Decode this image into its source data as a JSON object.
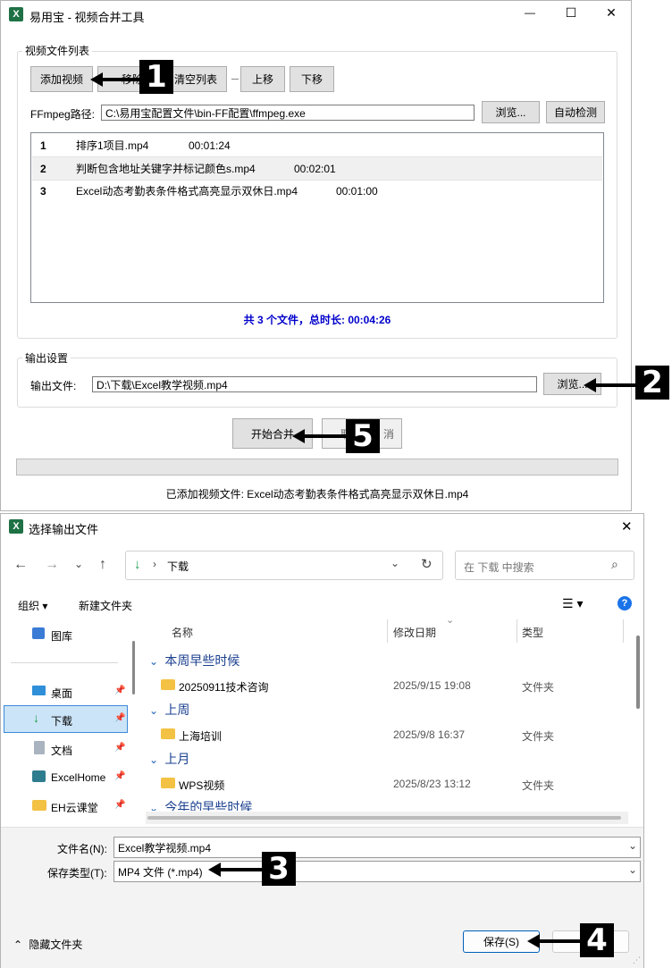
{
  "merge_tool": {
    "title": "易用宝 - 视频合并工具",
    "app_icon": "X",
    "window_controls": {
      "minimize": "—",
      "maximize": "☐",
      "close": "✕"
    },
    "file_group_label": "视频文件列表",
    "buttons": {
      "add": "添加视频",
      "remove": "移除选",
      "clear": "清空列表",
      "up": "上移",
      "down": "下移"
    },
    "ffmpeg_label": "FFmpeg路径:",
    "ffmpeg_path": "C:\\易用宝配置文件\\bin-FF配置\\ffmpeg.exe",
    "browse": "浏览...",
    "auto_detect": "自动检测",
    "files": [
      {
        "index": "1",
        "name": "排序1项目.mp4",
        "duration": "00:01:24"
      },
      {
        "index": "2",
        "name": "判断包含地址关键字并标记颜色s.mp4",
        "duration": "00:02:01"
      },
      {
        "index": "3",
        "name": "Excel动态考勤表条件格式高亮显示双休日.mp4",
        "duration": "00:01:00"
      }
    ],
    "summary": "共 3 个文件，总时长: 00:04:26",
    "output_group_label": "输出设置",
    "output_label": "输出文件:",
    "output_path": "D:\\下载\\Excel教学视频.mp4",
    "output_browse": "浏览...",
    "start_merge": "开始合并",
    "cancel_partial": "取",
    "cancel_tail": "消",
    "progress": 0,
    "status": "已添加视频文件: Excel动态考勤表条件格式高亮显示双休日.mp4"
  },
  "save_dialog": {
    "title": "选择输出文件",
    "close": "✕",
    "breadcrumb": "下载",
    "search_placeholder": "在 下载 中搜索",
    "organize": "组织 ▾",
    "new_folder": "新建文件夹",
    "nav_items": [
      {
        "label": "图库",
        "icon": "gallery-icon"
      },
      {
        "label": "桌面",
        "icon": "desktop-icon"
      },
      {
        "label": "下载",
        "icon": "download-icon"
      },
      {
        "label": "文档",
        "icon": "documents-icon"
      },
      {
        "label": "ExcelHome",
        "icon": "network-icon"
      },
      {
        "label": "EH云课堂",
        "icon": "folder-icon"
      }
    ],
    "columns": {
      "name": "名称",
      "date": "修改日期",
      "type": "类型"
    },
    "groups": [
      {
        "label": "本周早些时候",
        "items": [
          {
            "name": "20250911技术咨询",
            "date": "2025/9/15 19:08",
            "type": "文件夹"
          }
        ]
      },
      {
        "label": "上周",
        "items": [
          {
            "name": "上海培训",
            "date": "2025/9/8 16:37",
            "type": "文件夹"
          }
        ]
      },
      {
        "label": "上月",
        "items": [
          {
            "name": "WPS视频",
            "date": "2025/8/23 13:12",
            "type": "文件夹"
          }
        ]
      },
      {
        "label": "今年的早些时候",
        "items": []
      }
    ],
    "filename_label": "文件名(N):",
    "filename_value": "Excel教学视频.mp4",
    "filetype_label": "保存类型(T):",
    "filetype_value": "MP4 文件 (*.mp4)",
    "hide_folders": "隐藏文件夹",
    "save": "保存(S)"
  },
  "markers": [
    "1",
    "2",
    "3",
    "4",
    "5"
  ]
}
